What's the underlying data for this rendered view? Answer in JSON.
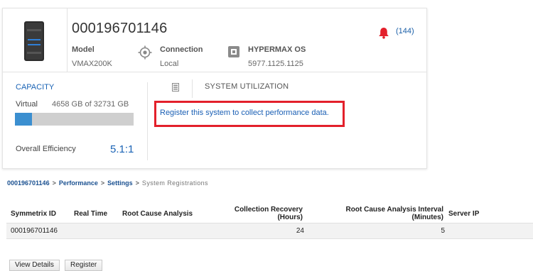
{
  "system": {
    "id": "000196701146",
    "model_label": "Model",
    "model_value": "VMAX200K",
    "connection_label": "Connection",
    "connection_value": "Local",
    "os_label": "HYPERMAX OS",
    "os_value": "5977.1125.1125",
    "alert_count": "(144)",
    "icons": {
      "server": "storage-array-icon",
      "connection": "connection-target-icon",
      "os": "os-chip-icon",
      "alert": "bell-alert-icon"
    },
    "colors": {
      "alert": "#e3202b",
      "link": "#1a63b5"
    }
  },
  "capacity": {
    "title": "CAPACITY",
    "virtual_label": "Virtual",
    "virtual_value": "4658 GB of 32731 GB",
    "used_fraction": 0.142,
    "efficiency_label": "Overall Efficiency",
    "efficiency_value": "5.1:1",
    "bar_color": "#3b8fd0"
  },
  "utilization": {
    "title": "SYSTEM UTILIZATION",
    "register_link": "Register this system to collect performance data.",
    "highlight_color": "#e3202b"
  },
  "breadcrumb": {
    "items": [
      "000196701146",
      "Performance",
      "Settings"
    ],
    "separator": ">",
    "current": "System Registrations"
  },
  "table": {
    "headers": {
      "symmetrix_id": "Symmetrix ID",
      "real_time": "Real Time",
      "rca": "Root Cause Analysis",
      "collection_recovery_1": "Collection Recovery",
      "collection_recovery_2": "(Hours)",
      "rca_interval_1": "Root Cause Analysis Interval",
      "rca_interval_2": "(Minutes)",
      "server_ip": "Server IP"
    },
    "rows": [
      {
        "symmetrix_id": "000196701146",
        "real_time": "",
        "rca": "",
        "collection_recovery": "24",
        "rca_interval": "5",
        "server_ip": ""
      }
    ]
  },
  "buttons": {
    "view_details": "View Details",
    "register": "Register"
  }
}
